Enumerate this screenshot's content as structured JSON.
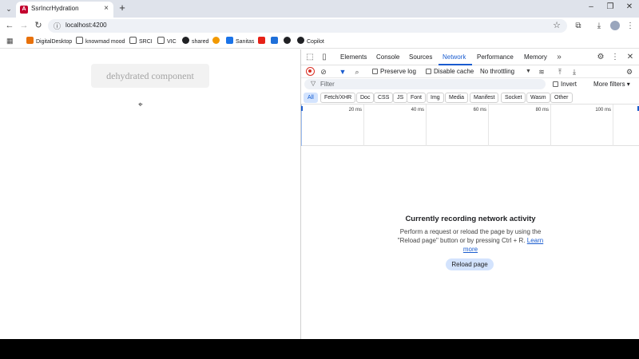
{
  "browser": {
    "tab_title": "SsrIncrHydration",
    "tab_icon_letter": "A",
    "url": "localhost:4200",
    "bookmarks": [
      {
        "label": "DigitalDesktop",
        "color": "#e8710a"
      },
      {
        "label": "knowmad mood",
        "color": "#555555"
      },
      {
        "label": "SRCI",
        "color": "#555555"
      },
      {
        "label": "VIC",
        "color": "#555555"
      },
      {
        "label": "shared",
        "color": "#202124"
      },
      {
        "label": "",
        "color": "#f29900"
      },
      {
        "label": "Sanitas",
        "color": "#1a73e8"
      },
      {
        "label": "",
        "color": "#e62117"
      },
      {
        "label": "",
        "color": "#1e6fd9"
      },
      {
        "label": "",
        "color": "#202124"
      },
      {
        "label": "Copilot",
        "color": "#202124"
      }
    ]
  },
  "page": {
    "component_text": "dehydrated component"
  },
  "devtools": {
    "tabs": [
      "Elements",
      "Console",
      "Sources",
      "Network",
      "Performance",
      "Memory"
    ],
    "active_tab": "Network",
    "preserve_log": "Preserve log",
    "disable_cache": "Disable cache",
    "throttling": "No throttling",
    "filter_placeholder": "Filter",
    "invert": "Invert",
    "more_filters": "More filters",
    "types": [
      "All",
      "Fetch/XHR",
      "Doc",
      "CSS",
      "JS",
      "Font",
      "Img",
      "Media",
      "Manifest",
      "Socket",
      "Wasm",
      "Other"
    ],
    "timeline_ticks": [
      "20 ms",
      "40 ms",
      "60 ms",
      "80 ms",
      "100 ms"
    ],
    "empty_title": "Currently recording network activity",
    "empty_body": "Perform a request or reload the page by using the \"Reload page\" button or by pressing Ctrl + R.",
    "learn_more": "Learn more",
    "reload_button": "Reload page"
  }
}
